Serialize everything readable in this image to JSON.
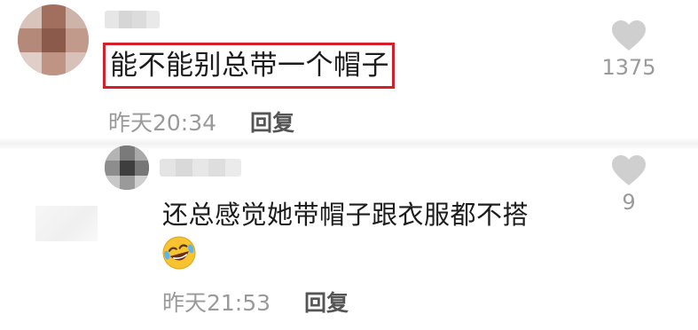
{
  "comments": [
    {
      "text": "能不能别总带一个帽子",
      "time": "昨天20:34",
      "reply_label": "回复",
      "like_count": "1375",
      "highlighted": true
    },
    {
      "text": "还总感觉她带帽子跟衣服都不搭",
      "time": "昨天21:53",
      "reply_label": "回复",
      "like_count": "9",
      "emoji": "laughing-crying-emoji"
    }
  ],
  "colors": {
    "highlight_border": "#d4202a",
    "meta_text": "#9a9a9a",
    "heart": "#cfcfcf"
  },
  "icons": {
    "like": "heart-icon"
  }
}
